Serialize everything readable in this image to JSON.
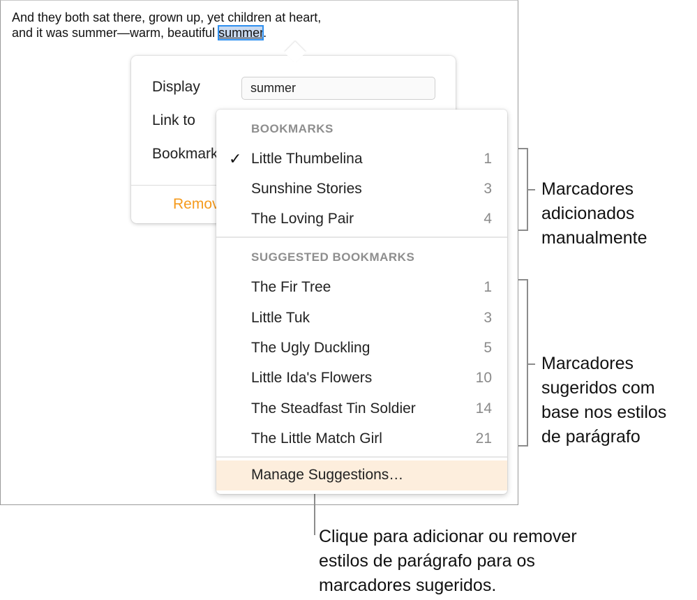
{
  "document": {
    "line1": "And they both sat there, grown up, yet children at heart,",
    "line2_before": "and it was summer—warm, beautiful ",
    "selected_word": "summer",
    "line2_after": "."
  },
  "popover": {
    "display_label": "Display",
    "display_value": "summer",
    "link_to_label": "Link to",
    "bookmark_label": "Bookmark",
    "remove_label": "Remove"
  },
  "menu": {
    "bookmarks_header": "BOOKMARKS",
    "bookmarks": [
      {
        "label": "Little Thumbelina",
        "page": "1",
        "checked": true
      },
      {
        "label": "Sunshine Stories",
        "page": "3",
        "checked": false
      },
      {
        "label": "The Loving Pair",
        "page": "4",
        "checked": false
      }
    ],
    "suggested_header": "SUGGESTED BOOKMARKS",
    "suggested": [
      {
        "label": "The Fir Tree",
        "page": "1"
      },
      {
        "label": "Little Tuk",
        "page": "3"
      },
      {
        "label": "The Ugly Duckling",
        "page": "5"
      },
      {
        "label": "Little Ida's Flowers",
        "page": "10"
      },
      {
        "label": "The Steadfast Tin Soldier",
        "page": "14"
      },
      {
        "label": "The Little Match Girl",
        "page": "21"
      }
    ],
    "manage_label": "Manage Suggestions…",
    "check_glyph": "✓"
  },
  "callouts": {
    "manual": [
      "Marcadores",
      "adicionados",
      "manualmente"
    ],
    "suggested": [
      "Marcadores",
      "sugeridos com",
      "base nos estilos",
      "de parágrafo"
    ],
    "manage": [
      "Clique para adicionar ou remover",
      "estilos de parágrafo para os",
      "marcadores sugeridos."
    ]
  },
  "colors": {
    "accent_orange": "#f59a1c",
    "selection_blue": "#2d8ff0",
    "manage_highlight": "#fdeedd"
  }
}
